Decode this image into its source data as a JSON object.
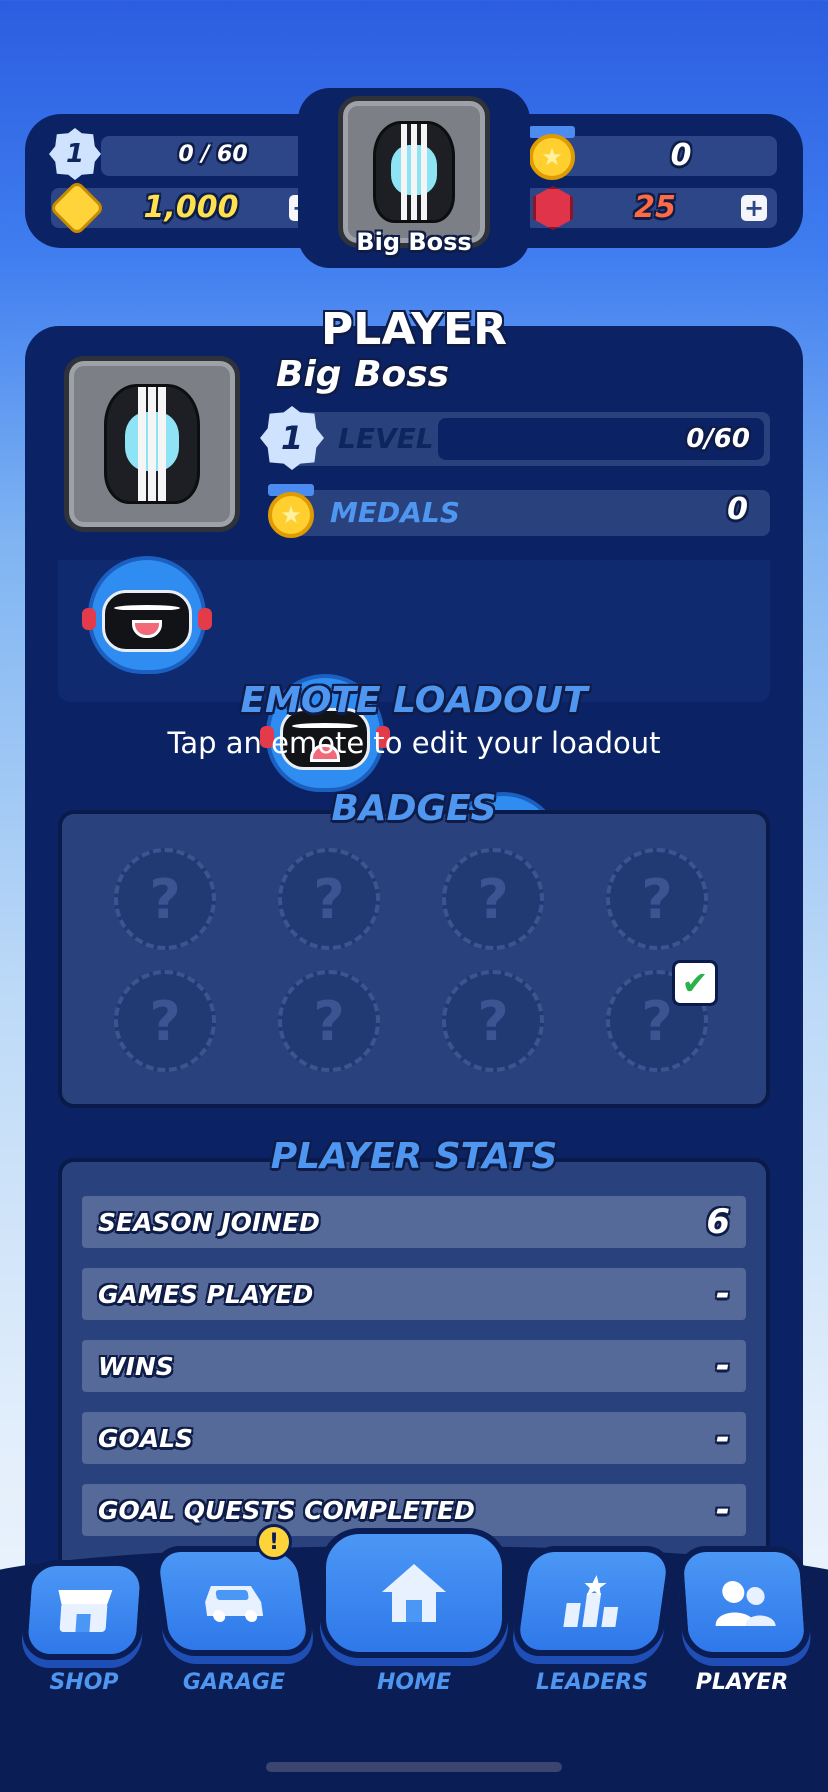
{
  "header": {
    "level": "1",
    "xp_text": "0 / 60",
    "coins": "1,000",
    "medals": "0",
    "gems": "25",
    "player_name": "Big Boss"
  },
  "player": {
    "title": "PLAYER",
    "name": "Big Boss",
    "level_badge": "1",
    "level_label": "LEVEL",
    "level_progress": "0/60",
    "level_progress_fraction": 0,
    "medals_label": "MEDALS",
    "medals_value": "0"
  },
  "emotes": {
    "title": "EMOTE LOADOUT",
    "subtitle": "Tap an emote to edit your loadout",
    "items": [
      "grin-emote",
      "crying-emote",
      "wink-emote",
      "shout-emote"
    ]
  },
  "badges": {
    "title": "BADGES",
    "slot_glyph": "?",
    "slots": 8
  },
  "stats": {
    "title": "PLAYER STATS",
    "rows": [
      {
        "label": "SEASON JOINED",
        "value": "6"
      },
      {
        "label": "GAMES PLAYED",
        "value": "-"
      },
      {
        "label": "WINS",
        "value": "-"
      },
      {
        "label": "GOALS",
        "value": "-"
      },
      {
        "label": "GOAL QUESTS COMPLETED",
        "value": "-"
      }
    ]
  },
  "nav": {
    "shop": "SHOP",
    "garage": "GARAGE",
    "garage_alert": "!",
    "home": "HOME",
    "leaders": "LEADERS",
    "player": "PLAYER"
  },
  "colors": {
    "panel": "#0b2364",
    "accent_blue": "#4f96f0",
    "gem_red": "#e0344a",
    "coin_yellow": "#ffd43a"
  }
}
